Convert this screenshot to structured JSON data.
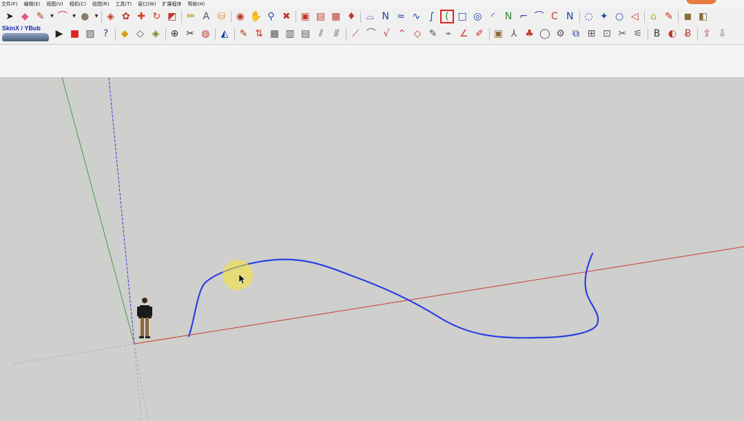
{
  "menu": [
    "文件(F)",
    "编辑(E)",
    "视图(V)",
    "相机(C)",
    "绘图(R)",
    "工具(T)",
    "窗口(W)",
    "扩展程序",
    "帮助(H)"
  ],
  "brand": {
    "text": "SkinX / YBub"
  },
  "toolbar_row1": [
    {
      "name": "select-tool-icon",
      "glyph": "➤",
      "color": "#202020"
    },
    {
      "name": "eraser-tool-icon",
      "glyph": "◆",
      "color": "#e05a7a"
    },
    {
      "name": "line-tool-icon",
      "glyph": "✎",
      "color": "#c0392b"
    },
    {
      "name": "line-dropdown-chevron-icon",
      "glyph": "▾",
      "color": "#333333"
    },
    {
      "name": "arc-tool-icon",
      "glyph": "⌒",
      "color": "#c0392b"
    },
    {
      "name": "arc-dropdown-chevron-icon",
      "glyph": "▾",
      "color": "#333333"
    },
    {
      "name": "shapes-tool-icon",
      "glyph": "●",
      "color": "#8a7a6a"
    },
    {
      "name": "shapes-dropdown-chevron-icon",
      "glyph": "▾",
      "color": "#333333"
    },
    {
      "name": "push-pull-tool-icon",
      "glyph": "◈",
      "color": "#c0392b"
    },
    {
      "name": "follow-me-tool-icon",
      "glyph": "✿",
      "color": "#c0392b"
    },
    {
      "name": "move-tool-icon",
      "glyph": "✚",
      "color": "#d23a2a"
    },
    {
      "name": "rotate-tool-icon",
      "glyph": "↻",
      "color": "#d23a2a"
    },
    {
      "name": "scale-tool-icon",
      "glyph": "◩",
      "color": "#c0392b"
    },
    {
      "name": "tape-measure-tool-icon",
      "glyph": "✏",
      "color": "#b8860b"
    },
    {
      "name": "text-tool-icon",
      "glyph": "A",
      "color": "#555555"
    },
    {
      "name": "paint-bucket-tool-icon",
      "glyph": "⛁",
      "color": "#c9a227"
    },
    {
      "name": "orbit-tool-icon",
      "glyph": "◉",
      "color": "#c0392b"
    },
    {
      "name": "pan-tool-icon",
      "glyph": "✋",
      "color": "#c9a227"
    },
    {
      "name": "zoom-tool-icon",
      "glyph": "⚲",
      "color": "#1e4fb0"
    },
    {
      "name": "zoom-extents-tool-icon",
      "glyph": "✖",
      "color": "#c0392b"
    },
    {
      "name": "warehouse-icon",
      "glyph": "▣",
      "color": "#c0392b"
    },
    {
      "name": "extension-warehouse-icon",
      "glyph": "▤",
      "color": "#c0392b"
    },
    {
      "name": "share-model-icon",
      "glyph": "▦",
      "color": "#c0392b"
    },
    {
      "name": "ruby-console-icon",
      "glyph": "♦",
      "color": "#c0392b"
    },
    {
      "name": "bezier-curve-icon",
      "glyph": "⌓",
      "color": "#1e3fa8"
    },
    {
      "name": "polyline-icon",
      "glyph": "Ν",
      "color": "#1e3fa8"
    },
    {
      "name": "freehand-curve-icon",
      "glyph": "≈",
      "color": "#1e3fa8"
    },
    {
      "name": "spline-icon",
      "glyph": "∿",
      "color": "#1e3fa8"
    },
    {
      "name": "cubic-bezier-icon",
      "glyph": "∫",
      "color": "#1e3fa8"
    },
    {
      "name": "arc-curve-icon",
      "glyph": "(",
      "color": "#2e8b3e"
    },
    {
      "name": "rectangle-curve-icon",
      "glyph": "□",
      "color": "#1e3fa8"
    },
    {
      "name": "spiral-curve-icon",
      "glyph": "◎",
      "color": "#1e3fa8"
    },
    {
      "name": "open-arc-icon",
      "glyph": "◜",
      "color": "#1e3fa8"
    },
    {
      "name": "zigzag-curve-icon",
      "glyph": "Ν",
      "color": "#2e8b3e"
    },
    {
      "name": "hook-curve-icon",
      "glyph": "⌐",
      "color": "#1e3fa8"
    },
    {
      "name": "arch-curve-icon",
      "glyph": "⌒",
      "color": "#1e3fa8"
    },
    {
      "name": "c-curve-icon",
      "glyph": "C",
      "color": "#c0392b"
    },
    {
      "name": "wave-curve-icon",
      "glyph": "Ν",
      "color": "#1e3fa8"
    },
    {
      "name": "circle-points-icon",
      "glyph": "◌",
      "color": "#1e3fa8"
    },
    {
      "name": "wrench-icon",
      "glyph": "✦",
      "color": "#1e3fa8"
    },
    {
      "name": "oval-curve-icon",
      "glyph": "○",
      "color": "#1e3fa8"
    },
    {
      "name": "teardrop-curve-icon",
      "glyph": "◁",
      "color": "#c0392b"
    },
    {
      "name": "soap-skin-icon",
      "glyph": "⌂",
      "color": "#c9a227"
    },
    {
      "name": "edit-curve-icon",
      "glyph": "✎",
      "color": "#c0392b"
    },
    {
      "name": "component-icon",
      "glyph": "◼",
      "color": "#8a6d3b"
    },
    {
      "name": "texture-icon",
      "glyph": "◧",
      "color": "#8a6d3b"
    }
  ],
  "toolbar_row2": [
    {
      "name": "play-button-icon",
      "glyph": "▶",
      "color": "#202020"
    },
    {
      "name": "record-button-icon",
      "glyph": "■",
      "color": "#e02020"
    },
    {
      "name": "picture-frame-icon",
      "glyph": "▨",
      "color": "#555555"
    },
    {
      "name": "help-question-icon",
      "glyph": "?",
      "color": "#1e3fa8"
    },
    {
      "name": "solid-box-icon",
      "glyph": "◆",
      "color": "#d4a017"
    },
    {
      "name": "open-box-icon",
      "glyph": "◇",
      "color": "#555555"
    },
    {
      "name": "flip-box-icon",
      "glyph": "◈",
      "color": "#6b8e23"
    },
    {
      "name": "axis-icon",
      "glyph": "⊕",
      "color": "#333333"
    },
    {
      "name": "section-plane-icon",
      "glyph": "✂",
      "color": "#333333"
    },
    {
      "name": "section-display-icon",
      "glyph": "◍",
      "color": "#c0392b"
    },
    {
      "name": "mirror-icon",
      "glyph": "◭",
      "color": "#1e3fa8"
    },
    {
      "name": "loft-icon",
      "glyph": "✎",
      "color": "#c0392b"
    },
    {
      "name": "extrude-icon",
      "glyph": "⇅",
      "color": "#c0392b"
    },
    {
      "name": "grid-icon",
      "glyph": "▦",
      "color": "#555555"
    },
    {
      "name": "panel-icon",
      "glyph": "▥",
      "color": "#555555"
    },
    {
      "name": "lattice-icon",
      "glyph": "▤",
      "color": "#555555"
    },
    {
      "name": "strips-icon",
      "glyph": "⫽",
      "color": "#555555"
    },
    {
      "name": "slats-icon",
      "glyph": "⫻",
      "color": "#555555"
    },
    {
      "name": "path-icon",
      "glyph": "⟋",
      "color": "#c0392b"
    },
    {
      "name": "offset-curve-icon",
      "glyph": "⌒",
      "color": "#555555"
    },
    {
      "name": "fillet-icon",
      "glyph": "√",
      "color": "#c0392b"
    },
    {
      "name": "chamfer-icon",
      "glyph": "⌃",
      "color": "#c0392b"
    },
    {
      "name": "tube-icon",
      "glyph": "◇",
      "color": "#c0392b"
    },
    {
      "name": "clone-icon",
      "glyph": "✎",
      "color": "#555555"
    },
    {
      "name": "joint-icon",
      "glyph": "⌁",
      "color": "#555555"
    },
    {
      "name": "angle-icon",
      "glyph": "∠",
      "color": "#c0392b"
    },
    {
      "name": "paint-icon",
      "glyph": "✐",
      "color": "#c0392b"
    },
    {
      "name": "box-stack-icon",
      "glyph": "▣",
      "color": "#8a6d3b"
    },
    {
      "name": "column-icon",
      "glyph": "⅄",
      "color": "#555555"
    },
    {
      "name": "rotate-copy-icon",
      "glyph": "♣",
      "color": "#c0392b"
    },
    {
      "name": "ring-icon",
      "glyph": "◯",
      "color": "#555555"
    },
    {
      "name": "gear-icon",
      "glyph": "⚙",
      "color": "#555555"
    },
    {
      "name": "layers-icon",
      "glyph": "⧉",
      "color": "#1e3fa8"
    },
    {
      "name": "window-icon",
      "glyph": "⊞",
      "color": "#555555"
    },
    {
      "name": "fence-icon",
      "glyph": "⊡",
      "color": "#555555"
    },
    {
      "name": "tools-icon",
      "glyph": "✂",
      "color": "#555555"
    },
    {
      "name": "brush-icon",
      "glyph": "⚟",
      "color": "#555555"
    },
    {
      "name": "three-d-text-icon",
      "glyph": "B",
      "color": "#333333"
    },
    {
      "name": "sweep-icon",
      "glyph": "◐",
      "color": "#c0392b"
    },
    {
      "name": "bu-plugin-icon",
      "glyph": "Ƀ",
      "color": "#c0392b"
    },
    {
      "name": "export-icon",
      "glyph": "⇪",
      "color": "#c0392b"
    },
    {
      "name": "import-icon",
      "glyph": "⇩",
      "color": "#8a6d3b"
    }
  ]
}
